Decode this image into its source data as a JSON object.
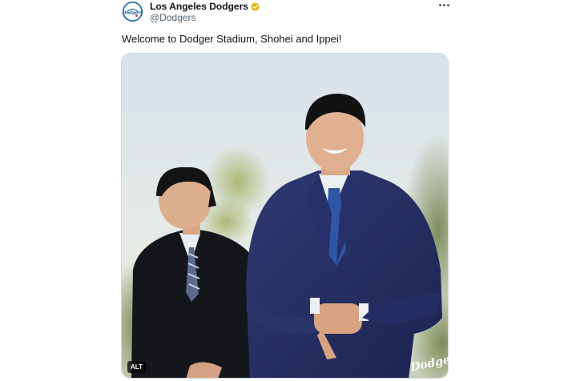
{
  "post": {
    "display_name": "Los Angeles Dodgers",
    "handle": "@Dodgers",
    "text": "Welcome to Dodger Stadium, Shohei and Ippei!",
    "verified_icon": "gold-verified-badge-icon",
    "more_icon": "more-options-icon"
  },
  "media": {
    "alt_badge": "ALT",
    "watermark": "Dodgers",
    "content": "photo"
  },
  "colors": {
    "text_primary": "#0f1419",
    "text_secondary": "#536471",
    "verified_gold": "#e2b719",
    "dodger_blue": "#005a9c",
    "suit_navy": "#232d5c"
  }
}
